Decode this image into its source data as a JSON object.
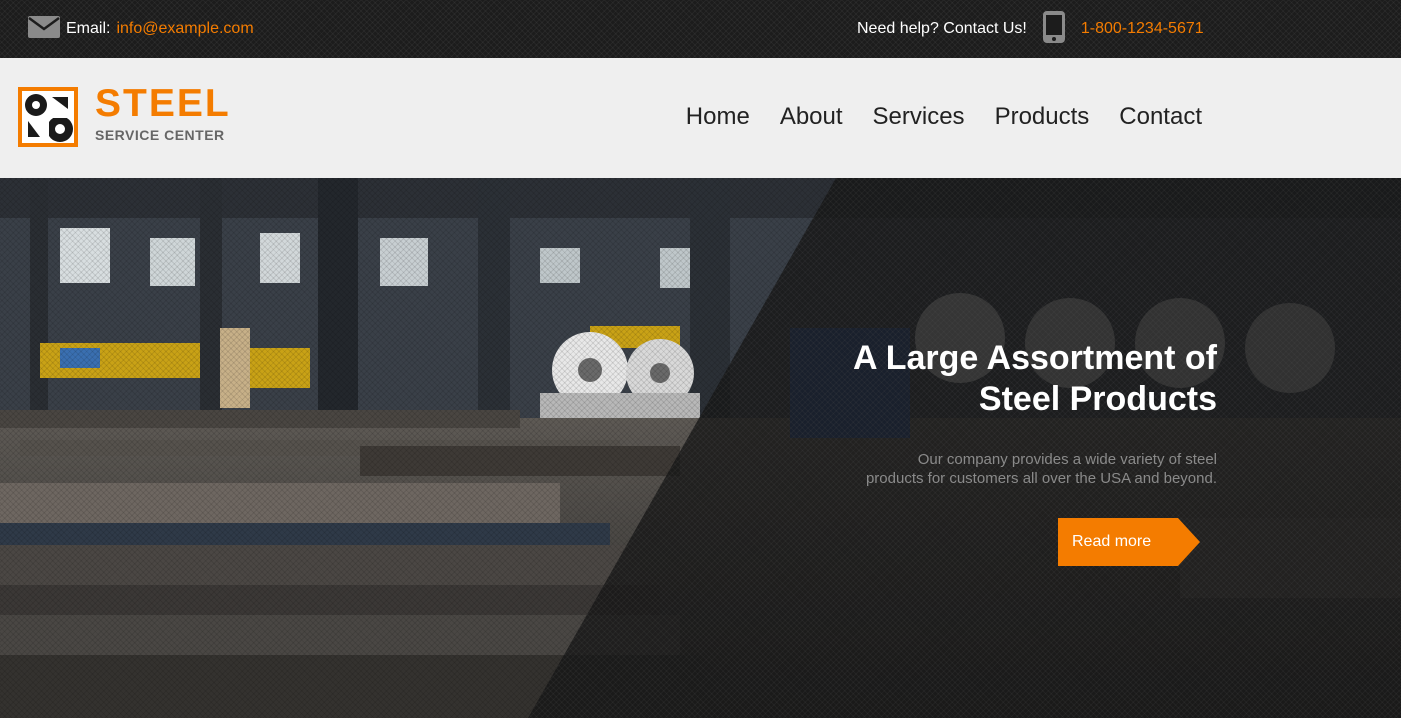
{
  "topbar": {
    "email_label": "Email:",
    "email_value": "info@example.com",
    "help_text": "Need help? Contact Us!",
    "phone": "1-800-1234-5671",
    "icons": {
      "email": "envelope-icon",
      "phone": "mobile-phone-icon"
    }
  },
  "header": {
    "logo": {
      "title": "STEEL",
      "subtitle": "SERVICE CENTER"
    },
    "nav": [
      "Home",
      "About",
      "Services",
      "Products",
      "Contact"
    ]
  },
  "hero": {
    "title_line1": "A Large Assortment of",
    "title_line2": "Steel Products",
    "description_line1": "Our company provides a wide variety of steel",
    "description_line2": "products for customers all over the USA and beyond.",
    "button_label": "Read more"
  },
  "colors": {
    "accent": "#f47c00",
    "topbar_bg": "#1c1c1c",
    "header_bg": "#efefef",
    "nav_text": "#222222"
  }
}
